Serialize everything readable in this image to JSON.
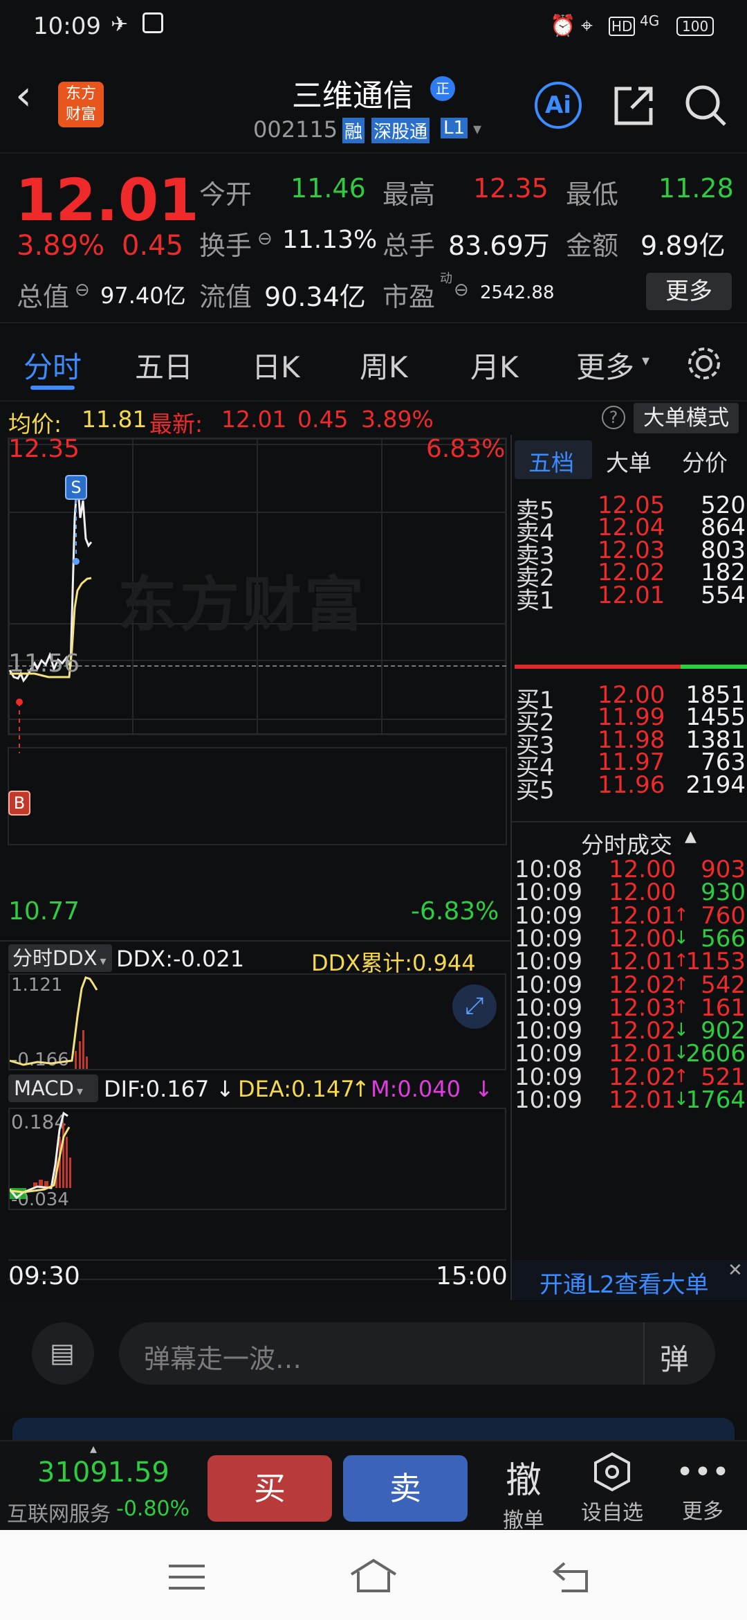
{
  "status": {
    "time": "10:09",
    "network": "4G",
    "battery": "100"
  },
  "header": {
    "stock_name": "三维通信",
    "badge": "正",
    "code": "002115",
    "tags": [
      "融",
      "深股通",
      "L1"
    ],
    "logo_line1": "东方",
    "logo_line2": "财富",
    "ai_label": "Ai"
  },
  "quote": {
    "price": "12.01",
    "change_pct": "3.89%",
    "change_abs": "0.45",
    "open_label": "今开",
    "open": "11.46",
    "high_label": "最高",
    "high": "12.35",
    "low_label": "最低",
    "low": "11.28",
    "turnover_label": "换手",
    "turnover": "11.13%",
    "volume_label": "总手",
    "volume": "83.69万",
    "amount_label": "金额",
    "amount": "9.89亿",
    "mcap_label": "总值",
    "mcap": "97.40亿",
    "float_label": "流值",
    "float": "90.34亿",
    "pe_label": "市盈",
    "pe_sup": "动",
    "pe": "2542.88",
    "more_button": "更多"
  },
  "tabs": [
    "分时",
    "五日",
    "日K",
    "周K",
    "月K",
    "更多"
  ],
  "infobar": {
    "avg_label": "均价:",
    "avg": "11.81",
    "latest_label": "最新:",
    "latest": "12.01",
    "chg": "0.45",
    "pct": "3.89%",
    "mode_button": "大单模式"
  },
  "chart": {
    "y_top": "12.35",
    "y_mid": "11.56",
    "y_bot": "10.77",
    "pct_top": "6.83%",
    "pct_bot": "-6.83%",
    "watermark": "东方财富",
    "sell_marker": "S",
    "buy_marker": "B",
    "ddx_selector": "分时DDX",
    "ddx": "DDX:-0.021",
    "ddx_cum": "DDX累计:0.944",
    "ddx_top": "1.121",
    "ddx_bot": "-0.166",
    "macd_selector": "MACD",
    "dif": "DIF:0.167",
    "dif_arrow": "↓",
    "dea": "DEA:0.147",
    "dea_arrow": "↑",
    "m": "M:0.040",
    "m_arrow": "↓",
    "macd_top": "0.184",
    "macd_bot": "-0.034",
    "t_start": "09:30",
    "t_end": "15:00"
  },
  "orderbook": {
    "tabs": [
      "五档",
      "大单",
      "分价"
    ],
    "asks": [
      {
        "label": "卖5",
        "price": "12.05",
        "vol": "520"
      },
      {
        "label": "卖4",
        "price": "12.04",
        "vol": "864"
      },
      {
        "label": "卖3",
        "price": "12.03",
        "vol": "803"
      },
      {
        "label": "卖2",
        "price": "12.02",
        "vol": "182"
      },
      {
        "label": "卖1",
        "price": "12.01",
        "vol": "554"
      }
    ],
    "bids": [
      {
        "label": "买1",
        "price": "12.00",
        "vol": "1851"
      },
      {
        "label": "买2",
        "price": "11.99",
        "vol": "1455"
      },
      {
        "label": "买3",
        "price": "11.98",
        "vol": "1381"
      },
      {
        "label": "买4",
        "price": "11.97",
        "vol": "763"
      },
      {
        "label": "买5",
        "price": "11.96",
        "vol": "2194"
      }
    ],
    "ticks_title": "分时成交",
    "ticks": [
      {
        "time": "10:08",
        "price": "12.00",
        "arrow": "",
        "vol": "903",
        "dir": "red"
      },
      {
        "time": "10:09",
        "price": "12.00",
        "arrow": "",
        "vol": "930",
        "dir": "green"
      },
      {
        "time": "10:09",
        "price": "12.01",
        "arrow": "↑",
        "vol": "760",
        "dir": "red"
      },
      {
        "time": "10:09",
        "price": "12.00",
        "arrow": "↓",
        "vol": "566",
        "dir": "green"
      },
      {
        "time": "10:09",
        "price": "12.01",
        "arrow": "↑",
        "vol": "1153",
        "dir": "red"
      },
      {
        "time": "10:09",
        "price": "12.02",
        "arrow": "↑",
        "vol": "542",
        "dir": "red"
      },
      {
        "time": "10:09",
        "price": "12.03",
        "arrow": "↑",
        "vol": "161",
        "dir": "red"
      },
      {
        "time": "10:09",
        "price": "12.02",
        "arrow": "↓",
        "vol": "902",
        "dir": "green"
      },
      {
        "time": "10:09",
        "price": "12.01",
        "arrow": "↓",
        "vol": "2606",
        "dir": "green"
      },
      {
        "time": "10:09",
        "price": "12.02",
        "arrow": "↑",
        "vol": "521",
        "dir": "red"
      },
      {
        "time": "10:09",
        "price": "12.01",
        "arrow": "↓",
        "vol": "1764",
        "dir": "green"
      }
    ],
    "l2_banner": "开通L2查看大单"
  },
  "danmu": {
    "placeholder": "弹幕走一波…",
    "send": "弹"
  },
  "tradebar": {
    "index_value": "31091.59",
    "index_name": "互联网服务",
    "index_pct": "-0.80%",
    "buy": "买",
    "sell": "卖",
    "cancel_glyph": "撤",
    "cancel_label": "撤单",
    "watch_label": "设自选",
    "more_label": "更多"
  },
  "colors": {
    "up": "#f02a2a",
    "down": "#2ecc40",
    "avg_line": "#f5e27a",
    "accent": "#2e86ff"
  }
}
